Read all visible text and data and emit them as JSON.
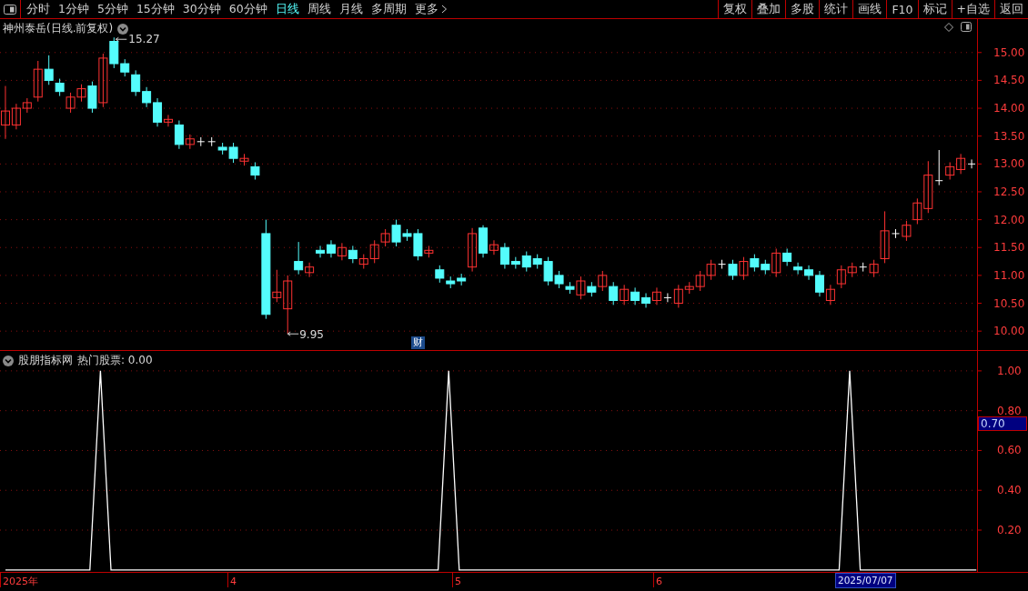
{
  "toolbar": {
    "periods": [
      {
        "label": "分时",
        "selected": false
      },
      {
        "label": "1分钟",
        "selected": false
      },
      {
        "label": "5分钟",
        "selected": false
      },
      {
        "label": "15分钟",
        "selected": false
      },
      {
        "label": "30分钟",
        "selected": false
      },
      {
        "label": "60分钟",
        "selected": false
      },
      {
        "label": "日线",
        "selected": true
      },
      {
        "label": "周线",
        "selected": false
      },
      {
        "label": "月线",
        "selected": false
      },
      {
        "label": "多周期",
        "selected": false
      }
    ],
    "more": "更多",
    "actions": [
      "复权",
      "叠加",
      "多股",
      "统计",
      "画线",
      "F10",
      "标记",
      "+自选",
      "返回"
    ]
  },
  "price_chart": {
    "title": "神州泰岳(日线.前复权)",
    "high_label": "15.27",
    "low_label": "9.95",
    "badge": "财",
    "chart_data": {
      "type": "candlestick",
      "grid": true,
      "ylim": [
        9.66,
        15.6
      ],
      "yticks": [
        {
          "value": 15,
          "label": "15.00"
        },
        {
          "value": 14.5,
          "label": "14.50"
        },
        {
          "value": 14,
          "label": "14.00"
        },
        {
          "value": 13.5,
          "label": "13.50"
        },
        {
          "value": 13,
          "label": "13.00"
        },
        {
          "value": 12.5,
          "label": "12.50"
        },
        {
          "value": 12,
          "label": "12.00"
        },
        {
          "value": 11.5,
          "label": "11.50"
        },
        {
          "value": 11,
          "label": "11.00"
        },
        {
          "value": 10.5,
          "label": "10.50"
        },
        {
          "value": 10,
          "label": "10.00"
        }
      ],
      "ohlc": [
        [
          13.7,
          14.4,
          13.45,
          13.95
        ],
        [
          13.7,
          14.08,
          13.62,
          14.0
        ],
        [
          14.0,
          14.18,
          13.92,
          14.1
        ],
        [
          14.2,
          14.85,
          14.12,
          14.7
        ],
        [
          14.7,
          14.95,
          14.42,
          14.5
        ],
        [
          14.45,
          14.53,
          14.22,
          14.3
        ],
        [
          14.0,
          14.28,
          13.92,
          14.2
        ],
        [
          14.2,
          14.43,
          14.12,
          14.35
        ],
        [
          14.4,
          14.48,
          13.92,
          14.0
        ],
        [
          14.1,
          14.98,
          14.02,
          14.9
        ],
        [
          15.2,
          15.27,
          14.72,
          14.8
        ],
        [
          14.8,
          14.88,
          14.57,
          14.65
        ],
        [
          14.6,
          14.68,
          14.22,
          14.3
        ],
        [
          14.3,
          14.38,
          14.02,
          14.1
        ],
        [
          14.1,
          14.18,
          13.67,
          13.75
        ],
        [
          13.75,
          13.88,
          13.67,
          13.8
        ],
        [
          13.7,
          13.78,
          13.27,
          13.35
        ],
        [
          13.35,
          13.53,
          13.27,
          13.45
        ],
        [
          13.4,
          13.48,
          13.32,
          13.4
        ],
        [
          13.4,
          13.48,
          13.32,
          13.4
        ],
        [
          13.3,
          13.38,
          13.17,
          13.25
        ],
        [
          13.3,
          13.38,
          13.02,
          13.1
        ],
        [
          13.05,
          13.18,
          12.97,
          13.1
        ],
        [
          12.95,
          13.03,
          12.72,
          12.8
        ],
        [
          11.75,
          12.0,
          10.22,
          10.3
        ],
        [
          10.6,
          11.1,
          10.52,
          10.7
        ],
        [
          10.4,
          11.0,
          9.95,
          10.9
        ],
        [
          11.25,
          11.6,
          11.02,
          11.1
        ],
        [
          11.05,
          11.23,
          10.97,
          11.15
        ],
        [
          11.45,
          11.53,
          11.32,
          11.4
        ],
        [
          11.55,
          11.63,
          11.32,
          11.4
        ],
        [
          11.35,
          11.58,
          11.27,
          11.5
        ],
        [
          11.45,
          11.53,
          11.22,
          11.3
        ],
        [
          11.2,
          11.38,
          11.12,
          11.3
        ],
        [
          11.3,
          11.63,
          11.22,
          11.55
        ],
        [
          11.6,
          11.83,
          11.52,
          11.75
        ],
        [
          11.9,
          12.0,
          11.52,
          11.6
        ],
        [
          11.75,
          11.83,
          11.62,
          11.7
        ],
        [
          11.75,
          11.83,
          11.27,
          11.35
        ],
        [
          11.4,
          11.53,
          11.32,
          11.45
        ],
        [
          11.1,
          11.18,
          10.87,
          10.95
        ],
        [
          10.9,
          10.98,
          10.77,
          10.85
        ],
        [
          10.95,
          11.03,
          10.82,
          10.9
        ],
        [
          11.15,
          11.85,
          11.07,
          11.75
        ],
        [
          11.85,
          11.9,
          11.32,
          11.4
        ],
        [
          11.45,
          11.63,
          11.37,
          11.55
        ],
        [
          11.5,
          11.58,
          11.12,
          11.2
        ],
        [
          11.25,
          11.33,
          11.12,
          11.2
        ],
        [
          11.35,
          11.43,
          11.07,
          11.15
        ],
        [
          11.3,
          11.38,
          11.12,
          11.2
        ],
        [
          11.25,
          11.33,
          10.82,
          10.9
        ],
        [
          11.0,
          11.08,
          10.77,
          10.85
        ],
        [
          10.8,
          10.88,
          10.67,
          10.75
        ],
        [
          10.65,
          10.98,
          10.57,
          10.9
        ],
        [
          10.8,
          10.88,
          10.62,
          10.7
        ],
        [
          10.8,
          11.08,
          10.72,
          11.0
        ],
        [
          10.8,
          10.88,
          10.47,
          10.55
        ],
        [
          10.55,
          10.83,
          10.47,
          10.75
        ],
        [
          10.7,
          10.78,
          10.47,
          10.55
        ],
        [
          10.6,
          10.68,
          10.42,
          10.5
        ],
        [
          10.55,
          10.78,
          10.47,
          10.7
        ],
        [
          10.6,
          10.68,
          10.52,
          10.6
        ],
        [
          10.5,
          10.83,
          10.42,
          10.75
        ],
        [
          10.75,
          10.88,
          10.67,
          10.8
        ],
        [
          10.8,
          11.08,
          10.72,
          11.0
        ],
        [
          11.0,
          11.28,
          10.92,
          11.2
        ],
        [
          11.2,
          11.28,
          11.12,
          11.2
        ],
        [
          11.2,
          11.28,
          10.92,
          11.0
        ],
        [
          11.0,
          11.33,
          10.92,
          11.25
        ],
        [
          11.3,
          11.38,
          11.07,
          11.15
        ],
        [
          11.2,
          11.28,
          11.02,
          11.1
        ],
        [
          11.05,
          11.48,
          10.97,
          11.4
        ],
        [
          11.4,
          11.48,
          11.17,
          11.25
        ],
        [
          11.15,
          11.23,
          11.02,
          11.1
        ],
        [
          11.1,
          11.18,
          10.92,
          11.0
        ],
        [
          11.0,
          11.08,
          10.62,
          10.7
        ],
        [
          10.55,
          10.83,
          10.47,
          10.75
        ],
        [
          10.85,
          11.18,
          10.77,
          11.1
        ],
        [
          11.05,
          11.23,
          10.97,
          11.15
        ],
        [
          11.15,
          11.23,
          11.07,
          11.15
        ],
        [
          11.05,
          11.28,
          10.97,
          11.2
        ],
        [
          11.3,
          12.15,
          11.22,
          11.8
        ],
        [
          11.75,
          11.83,
          11.67,
          11.75
        ],
        [
          11.7,
          11.98,
          11.62,
          11.9
        ],
        [
          12.0,
          12.38,
          11.92,
          12.3
        ],
        [
          12.2,
          13.05,
          12.12,
          12.8
        ],
        [
          12.7,
          13.25,
          12.62,
          12.7
        ],
        [
          12.8,
          13.03,
          12.72,
          12.95
        ],
        [
          12.9,
          13.18,
          12.82,
          13.1
        ],
        [
          13.0,
          13.08,
          12.92,
          13.0
        ]
      ]
    }
  },
  "indicator": {
    "name": "股朋指标网",
    "reading": "热门股票: 0.00",
    "cursor_value": "0.70",
    "chart_data": {
      "type": "line",
      "grid": true,
      "ylim": [
        -0.01,
        1.1
      ],
      "series": [
        {
          "color": "#ffffff",
          "values": [
            0,
            0,
            0,
            0,
            0,
            0,
            0,
            0,
            0,
            1,
            0,
            0,
            0,
            0,
            0,
            0,
            0,
            0,
            0,
            0,
            0,
            0,
            0,
            0,
            0,
            0,
            0,
            0,
            0,
            0,
            0,
            0,
            0,
            0,
            0,
            0,
            0,
            0,
            0,
            0,
            0,
            0,
            1,
            0,
            0,
            0,
            0,
            0,
            0,
            0,
            0,
            0,
            0,
            0,
            0,
            0,
            0,
            0,
            0,
            0,
            0,
            0,
            0,
            0,
            0,
            0,
            0,
            0,
            0,
            0,
            0,
            0,
            0,
            0,
            0,
            0,
            0,
            0,
            0,
            0,
            1,
            0,
            0,
            0,
            0,
            0,
            0,
            0,
            0,
            0,
            0,
            0,
            0
          ]
        }
      ],
      "yticks": [
        {
          "value": 1.0,
          "label": "1.00"
        },
        {
          "value": 0.8,
          "label": "0.80"
        },
        {
          "value": 0.6,
          "label": "0.60"
        },
        {
          "value": 0.4,
          "label": "0.40"
        },
        {
          "value": 0.2,
          "label": "0.20"
        }
      ]
    }
  },
  "time_axis": {
    "labels": [
      "2025年",
      "4",
      "5",
      "6"
    ],
    "cursor_date": "2025/07/07"
  }
}
